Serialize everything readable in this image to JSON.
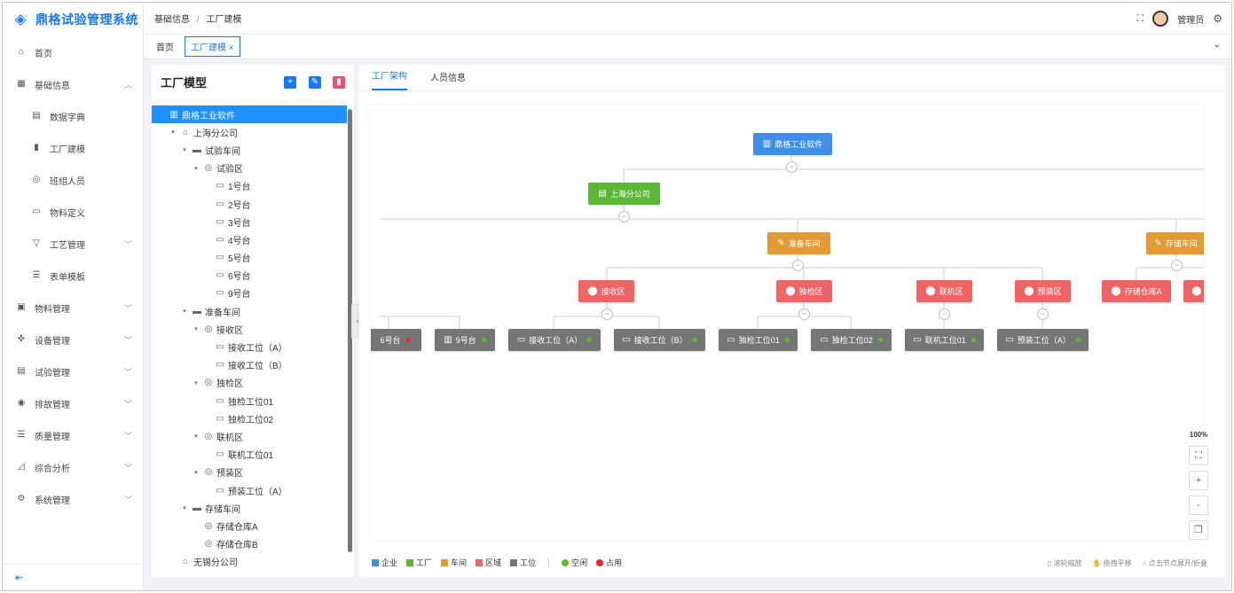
{
  "app": {
    "title": "鼎格试验管理系统"
  },
  "sidebar": {
    "items": [
      {
        "label": "首页",
        "icon": "home-icon",
        "glyph": "⌂"
      },
      {
        "label": "基础信息",
        "icon": "grid-icon",
        "glyph": "▦",
        "expanded": true
      },
      {
        "label": "数据字典",
        "icon": "dictionary-icon",
        "glyph": "▤",
        "sub": true
      },
      {
        "label": "工厂建模",
        "icon": "bar-chart-icon",
        "glyph": "▮",
        "sub": true
      },
      {
        "label": "班组人员",
        "icon": "person-icon",
        "glyph": "◎",
        "sub": true
      },
      {
        "label": "物料定义",
        "icon": "box-icon",
        "glyph": "▭",
        "sub": true
      },
      {
        "label": "工艺管理",
        "icon": "filter-icon",
        "glyph": "▽",
        "sub": true,
        "collapsed": true
      },
      {
        "label": "表单模板",
        "icon": "list-icon",
        "glyph": "☰",
        "sub": true
      },
      {
        "label": "物料管理",
        "icon": "material-icon",
        "glyph": "▣",
        "collapsed": true
      },
      {
        "label": "设备管理",
        "icon": "device-icon",
        "glyph": "✜",
        "collapsed": true
      },
      {
        "label": "试验管理",
        "icon": "test-icon",
        "glyph": "▤",
        "collapsed": true
      },
      {
        "label": "排故管理",
        "icon": "fault-icon",
        "glyph": "◉",
        "collapsed": true
      },
      {
        "label": "质量管理",
        "icon": "quality-icon",
        "glyph": "☰",
        "collapsed": true
      },
      {
        "label": "综合分析",
        "icon": "analysis-icon",
        "glyph": "◿",
        "collapsed": true
      },
      {
        "label": "系统管理",
        "icon": "settings-icon",
        "glyph": "⚙",
        "collapsed": true
      }
    ],
    "collapse_glyph": "⇤"
  },
  "header": {
    "breadcrumb": [
      "基础信息",
      "工厂建模"
    ],
    "breadcrumb_sep": "/",
    "user": "管理员"
  },
  "tabs": [
    {
      "label": "首页",
      "active": false
    },
    {
      "label": "工厂建模 ×",
      "active": true
    }
  ],
  "tree_panel": {
    "title": "工厂模型",
    "buttons": [
      {
        "name": "add-button",
        "glyph": "+",
        "color": "#1677ff"
      },
      {
        "name": "edit-button",
        "glyph": "✎",
        "color": "#1677ff"
      },
      {
        "name": "delete-button",
        "glyph": "🗑",
        "color": "#ef4d73"
      }
    ],
    "nodes": [
      {
        "label": "鼎格工业软件",
        "level": 0,
        "icon": "building-icon",
        "glyph": "▥",
        "arrow": "",
        "selected": true
      },
      {
        "label": "上海分公司",
        "level": 1,
        "icon": "home-icon",
        "glyph": "⌂",
        "arrow": "▾"
      },
      {
        "label": "试验车间",
        "level": 2,
        "icon": "workshop-icon",
        "glyph": "▬",
        "arrow": "▾"
      },
      {
        "label": "试验区",
        "level": 3,
        "icon": "location-icon",
        "glyph": "◎",
        "arrow": "▾"
      },
      {
        "label": "1号台",
        "level": 4,
        "icon": "monitor-icon",
        "glyph": "▭",
        "arrow": ""
      },
      {
        "label": "2号台",
        "level": 4,
        "icon": "monitor-icon",
        "glyph": "▭",
        "arrow": ""
      },
      {
        "label": "3号台",
        "level": 4,
        "icon": "monitor-icon",
        "glyph": "▭",
        "arrow": ""
      },
      {
        "label": "4号台",
        "level": 4,
        "icon": "monitor-icon",
        "glyph": "▭",
        "arrow": ""
      },
      {
        "label": "5号台",
        "level": 4,
        "icon": "monitor-icon",
        "glyph": "▭",
        "arrow": ""
      },
      {
        "label": "6号台",
        "level": 4,
        "icon": "monitor-icon",
        "glyph": "▭",
        "arrow": ""
      },
      {
        "label": "9号台",
        "level": 4,
        "icon": "monitor-icon",
        "glyph": "▭",
        "arrow": ""
      },
      {
        "label": "准备车间",
        "level": 2,
        "icon": "workshop-icon",
        "glyph": "▬",
        "arrow": "▾"
      },
      {
        "label": "接收区",
        "level": 3,
        "icon": "location-icon",
        "glyph": "◎",
        "arrow": "▾"
      },
      {
        "label": "接收工位（A）",
        "level": 4,
        "icon": "monitor-icon",
        "glyph": "▭",
        "arrow": ""
      },
      {
        "label": "接收工位（B）",
        "level": 4,
        "icon": "monitor-icon",
        "glyph": "▭",
        "arrow": ""
      },
      {
        "label": "独检区",
        "level": 3,
        "icon": "location-icon",
        "glyph": "◎",
        "arrow": "▾"
      },
      {
        "label": "独检工位01",
        "level": 4,
        "icon": "monitor-icon",
        "glyph": "▭",
        "arrow": ""
      },
      {
        "label": "独检工位02",
        "level": 4,
        "icon": "monitor-icon",
        "glyph": "▭",
        "arrow": ""
      },
      {
        "label": "联机区",
        "level": 3,
        "icon": "location-icon",
        "glyph": "◎",
        "arrow": "▾"
      },
      {
        "label": "联机工位01",
        "level": 4,
        "icon": "monitor-icon",
        "glyph": "▭",
        "arrow": ""
      },
      {
        "label": "预装区",
        "level": 3,
        "icon": "location-icon",
        "glyph": "◎",
        "arrow": "▾"
      },
      {
        "label": "预装工位（A）",
        "level": 4,
        "icon": "monitor-icon",
        "glyph": "▭",
        "arrow": ""
      },
      {
        "label": "存储车间",
        "level": 2,
        "icon": "workshop-icon",
        "glyph": "▬",
        "arrow": "▾"
      },
      {
        "label": "存储仓库A",
        "level": 3,
        "icon": "location-icon",
        "glyph": "◎",
        "arrow": ""
      },
      {
        "label": "存储仓库B",
        "level": 3,
        "icon": "location-icon",
        "glyph": "◎",
        "arrow": ""
      },
      {
        "label": "无锡分公司",
        "level": 1,
        "icon": "home-icon",
        "glyph": "⌂",
        "arrow": ""
      }
    ]
  },
  "right_tabs": [
    {
      "label": "工厂架构",
      "active": true
    },
    {
      "label": "人员信息",
      "active": false
    }
  ],
  "org": {
    "company": {
      "label": "鼎格工业软件",
      "glyph": "▥"
    },
    "factory": {
      "label": "上海分公司",
      "glyph": "▤"
    },
    "workshops": [
      {
        "label": "准备车间",
        "glyph": "🔧"
      },
      {
        "label": "存储车间",
        "glyph": "🔧"
      }
    ],
    "areas": [
      {
        "label": "接收区",
        "glyph": "⬤"
      },
      {
        "label": "独检区",
        "glyph": "⬤"
      },
      {
        "label": "联机区",
        "glyph": "⬤"
      },
      {
        "label": "预装区",
        "glyph": "⬤"
      },
      {
        "label": "存储仓库A",
        "glyph": "⬤"
      }
    ],
    "stations": [
      {
        "label": "6号台",
        "status": "busy"
      },
      {
        "label": "9号台",
        "status": "idle"
      },
      {
        "label": "接收工位（A）",
        "status": "idle"
      },
      {
        "label": "接收工位（B）",
        "status": "idle"
      },
      {
        "label": "独检工位01",
        "status": "idle"
      },
      {
        "label": "独检工位02",
        "status": "idle"
      },
      {
        "label": "联机工位01",
        "status": "idle"
      },
      {
        "label": "预装工位（A）",
        "status": "idle"
      }
    ],
    "collapse_glyph": "−"
  },
  "zoom": {
    "level": "100%",
    "fit_glyph": "⛶",
    "plus": "+",
    "minus": "-",
    "copy_glyph": "❐"
  },
  "legend": {
    "types": [
      {
        "label": "企业",
        "color": "#3d8fe8"
      },
      {
        "label": "工厂",
        "color": "#5ab835"
      },
      {
        "label": "车间",
        "color": "#e39a33"
      },
      {
        "label": "区域",
        "color": "#ef6565"
      },
      {
        "label": "工位",
        "color": "#757575"
      }
    ],
    "status": [
      {
        "label": "空闲",
        "color": "#52c41a"
      },
      {
        "label": "占用",
        "color": "#f5222d"
      }
    ],
    "hints": [
      "滚轮缩放",
      "拖拽平移",
      "点击节点展开/折叠"
    ]
  }
}
